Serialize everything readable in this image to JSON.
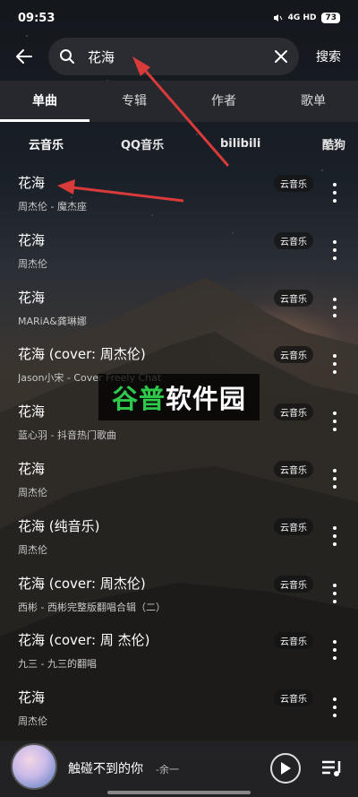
{
  "status_bar": {
    "time": "09:53",
    "network": "4G HD",
    "battery": "73"
  },
  "search": {
    "query": "花海",
    "submit_label": "搜索"
  },
  "tabs": [
    {
      "label": "单曲",
      "active": true
    },
    {
      "label": "专辑",
      "active": false
    },
    {
      "label": "作者",
      "active": false
    },
    {
      "label": "歌单",
      "active": false
    }
  ],
  "sources": [
    {
      "label": "云音乐",
      "active": true
    },
    {
      "label": "QQ音乐",
      "active": false
    },
    {
      "label": "bilibili",
      "active": false
    },
    {
      "label": "酷狗",
      "active": false
    }
  ],
  "songs": [
    {
      "title": "花海",
      "subtitle": "周杰伦 - 魔杰座",
      "badge": "云音乐"
    },
    {
      "title": "花海",
      "subtitle": "周杰伦",
      "badge": "云音乐"
    },
    {
      "title": "花海",
      "subtitle": "MARiA&龚琳娜",
      "badge": "云音乐"
    },
    {
      "title": "花海 (cover: 周杰伦)",
      "subtitle": "Jason小宋 - Cover Freely Chat",
      "badge": "云音乐"
    },
    {
      "title": "花海",
      "subtitle": "蓝心羽 - 抖音热门歌曲",
      "badge": "云音乐"
    },
    {
      "title": "花海",
      "subtitle": "周杰伦",
      "badge": "云音乐"
    },
    {
      "title": "花海 (纯音乐)",
      "subtitle": "周杰伦",
      "badge": "云音乐"
    },
    {
      "title": "花海 (cover: 周杰伦)",
      "subtitle": "西彬 - 西彬完整版翻唱合辑（二）",
      "badge": "云音乐"
    },
    {
      "title": "花海 (cover: 周 杰伦)",
      "subtitle": "九三 - 九三的翻唱",
      "badge": "云音乐"
    },
    {
      "title": "花海",
      "subtitle": "周杰伦",
      "badge": "云音乐"
    }
  ],
  "watermark": {
    "part1": "谷普",
    "part2": "软件园"
  },
  "now_playing": {
    "title": "触碰不到的你",
    "artist": "-余一"
  },
  "colors": {
    "accent_arrow": "#d93a3a",
    "watermark_green": "#2ec84b"
  }
}
